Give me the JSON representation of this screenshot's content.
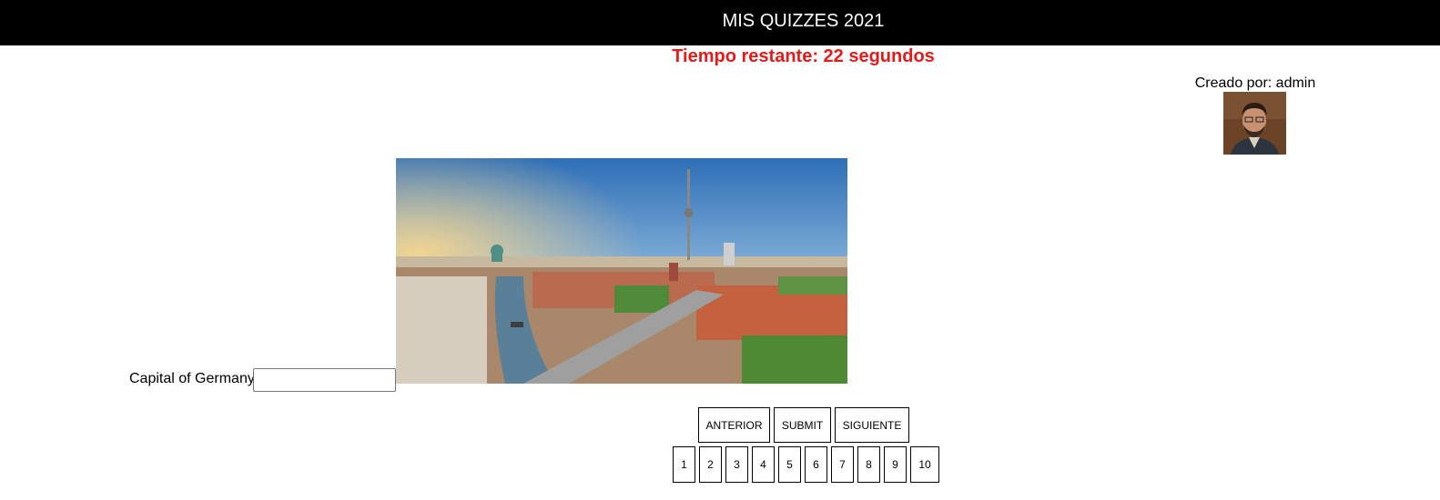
{
  "header": {
    "title": "MIS QUIZZES 2021"
  },
  "timer": {
    "text": "Tiempo restante: 22 segundos",
    "color": "#e31b1b"
  },
  "author": {
    "label": "Creado por: admin",
    "avatar_icon": "user-photo"
  },
  "question": {
    "label": "Capital of Germany",
    "answer_value": "",
    "image_icon": "city-skyline-photo"
  },
  "controls": {
    "prev_label": "ANTERIOR",
    "submit_label": "SUBMIT",
    "next_label": "SIGUIENTE"
  },
  "pager": {
    "pages": [
      "1",
      "2",
      "3",
      "4",
      "5",
      "6",
      "7",
      "8",
      "9",
      "10"
    ]
  }
}
